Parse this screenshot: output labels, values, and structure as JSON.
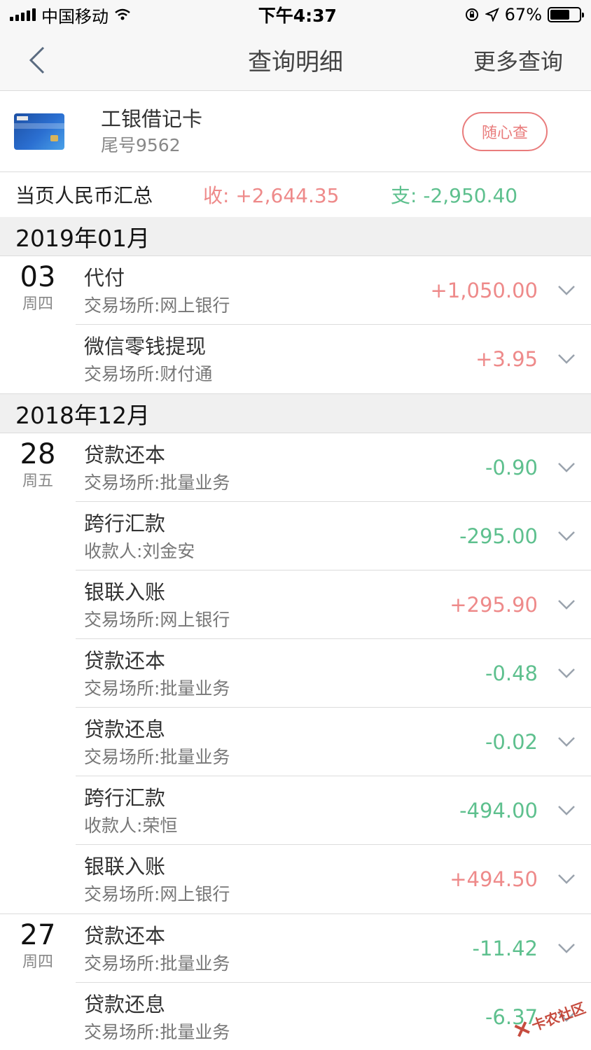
{
  "status_bar": {
    "carrier": "中国移动",
    "time": "下午4:37",
    "battery": "67%",
    "battery_level": 0.67
  },
  "nav": {
    "title": "查询明细",
    "more": "更多查询"
  },
  "card": {
    "name": "工银借记卡",
    "number": "尾号9562",
    "query_button": "随心查"
  },
  "summary": {
    "label": "当页人民币汇总",
    "income": "收: +2,644.35",
    "expense": "支: -2,950.40"
  },
  "months": [
    {
      "label": "2019年01月",
      "days": [
        {
          "day": "03",
          "weekday": "周四",
          "transactions": [
            {
              "title": "代付",
              "sub": "交易场所:网上银行",
              "amount": "+1,050.00"
            },
            {
              "title": "微信零钱提现",
              "sub": "交易场所:财付通",
              "amount": "+3.95"
            }
          ]
        }
      ]
    },
    {
      "label": "2018年12月",
      "days": [
        {
          "day": "28",
          "weekday": "周五",
          "transactions": [
            {
              "title": "贷款还本",
              "sub": "交易场所:批量业务",
              "amount": "-0.90"
            },
            {
              "title": "跨行汇款",
              "sub": "收款人:刘金安",
              "amount": "-295.00"
            },
            {
              "title": "银联入账",
              "sub": "交易场所:网上银行",
              "amount": "+295.90"
            },
            {
              "title": "贷款还本",
              "sub": "交易场所:批量业务",
              "amount": "-0.48"
            },
            {
              "title": "贷款还息",
              "sub": "交易场所:批量业务",
              "amount": "-0.02"
            },
            {
              "title": "跨行汇款",
              "sub": "收款人:荣恒",
              "amount": "-494.00"
            },
            {
              "title": "银联入账",
              "sub": "交易场所:网上银行",
              "amount": "+494.50"
            }
          ]
        },
        {
          "day": "27",
          "weekday": "周四",
          "transactions": [
            {
              "title": "贷款还本",
              "sub": "交易场所:批量业务",
              "amount": "-11.42"
            },
            {
              "title": "贷款还息",
              "sub": "交易场所:批量业务",
              "amount": "-6.37"
            }
          ]
        }
      ]
    }
  ],
  "watermark": "卡农社区",
  "colors": {
    "income": "#ee8a8a",
    "expense": "#5ec08e",
    "accent": "#e97c7c"
  }
}
